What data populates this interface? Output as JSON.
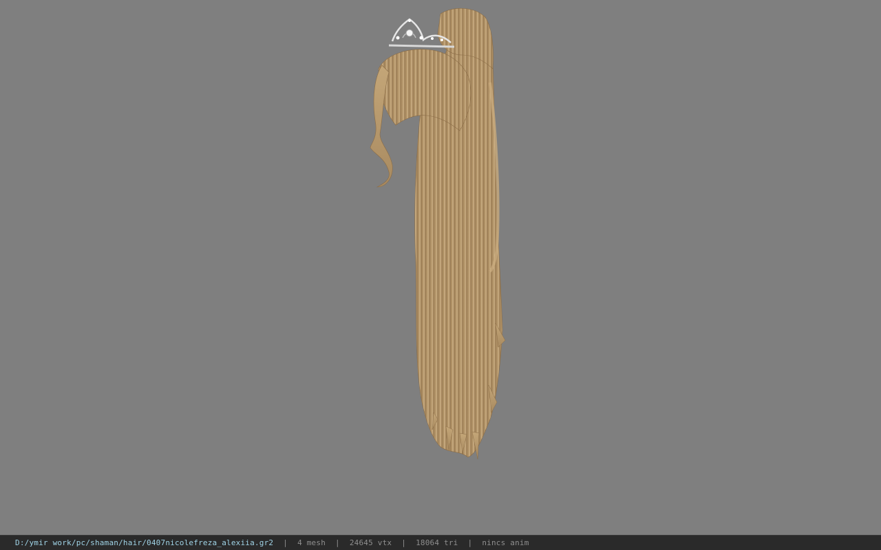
{
  "viewer": {
    "background_color": "#7f7f7f",
    "model_icon": "hair-model-with-tiara-icon",
    "hair_color": "#b89a6e"
  },
  "status": {
    "path": "D:/ymir work/pc/shaman/hair/0407nicolefreza_alexiia.gr2",
    "separator": "|",
    "mesh": "4 mesh",
    "vtx": "24645 vtx",
    "tri": "18064 tri",
    "anim": "nincs anim",
    "path_color": "#9fd3e6"
  }
}
